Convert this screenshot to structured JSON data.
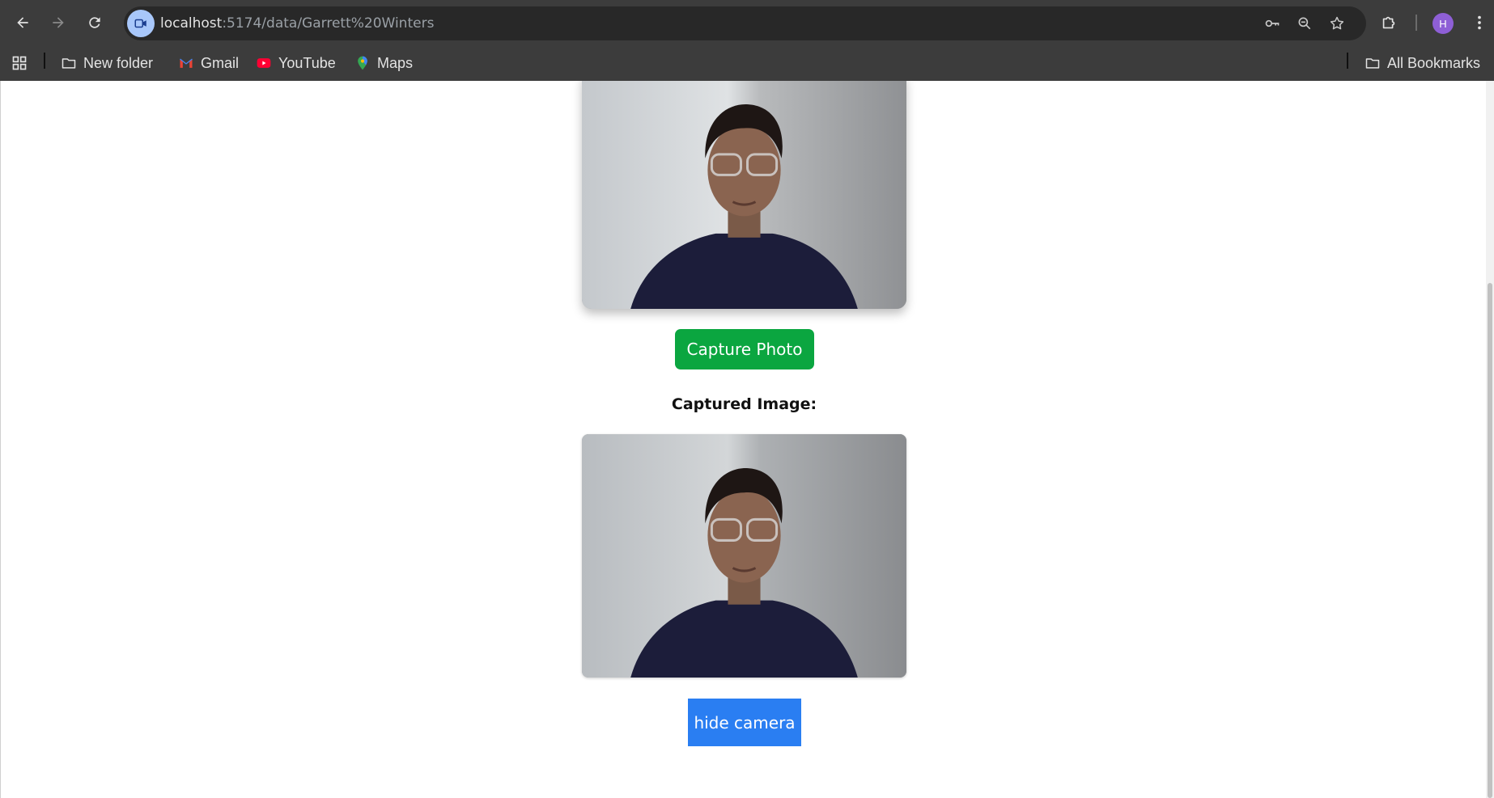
{
  "browser": {
    "url_host": "localhost",
    "url_path": ":5174/data/Garrett%20Winters",
    "profile_initial": "H",
    "icons": [
      "back-arrow-icon",
      "forward-arrow-icon",
      "reload-icon",
      "camera-site-icon",
      "password-key-icon",
      "zoom-icon",
      "bookmark-star-icon",
      "extensions-puzzle-icon",
      "kebab-menu-icon"
    ]
  },
  "bookmarks": {
    "items": [
      {
        "label": "New folder",
        "icon": "folder-icon"
      },
      {
        "label": "Gmail",
        "icon": "gmail-icon"
      },
      {
        "label": "YouTube",
        "icon": "youtube-icon"
      },
      {
        "label": "Maps",
        "icon": "maps-pin-icon"
      }
    ],
    "all_label": "All Bookmarks"
  },
  "camera": {
    "capture_button": "Capture Photo",
    "captured_heading": "Captured Image:",
    "hide_button": "hide camera"
  },
  "colors": {
    "capture_button": "#0ba640",
    "hide_button": "#2a7ef2",
    "chrome_bg": "#3c3c3c"
  }
}
